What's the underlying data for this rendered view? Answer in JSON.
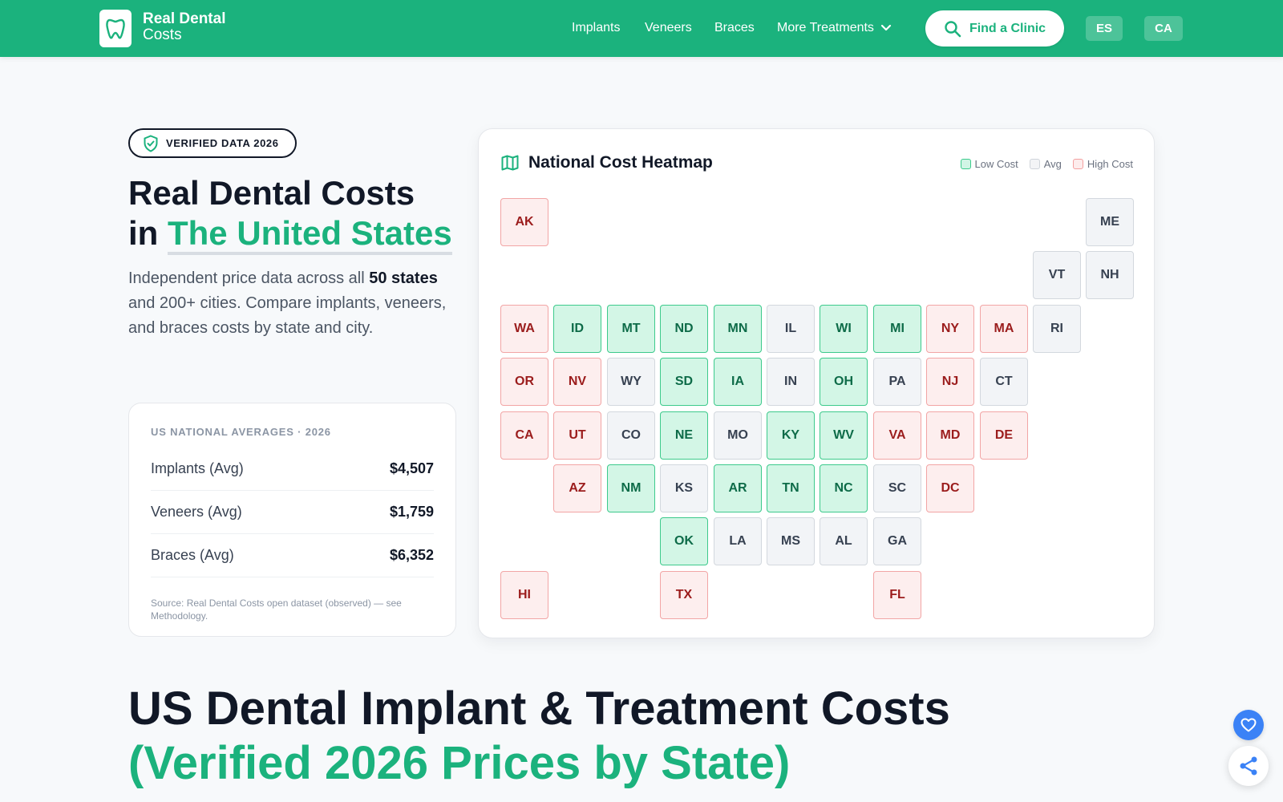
{
  "header": {
    "logo_line1": "Real Dental",
    "logo_line2": "Costs",
    "nav": [
      "Implants",
      "Veneers",
      "Braces",
      "More Treatments"
    ],
    "find_clinic": "Find a Clinic",
    "languages": [
      "ES",
      "CA"
    ]
  },
  "hero": {
    "badge": "VERIFIED DATA 2026",
    "title_line1": "Real Dental Costs",
    "title_prefix": "in ",
    "title_accent": "The United States",
    "desc_part1": "Independent price data across all ",
    "desc_bold": "50 states",
    "desc_part2": " and 200+ cities. Compare implants, veneers, and braces costs by state and city."
  },
  "averages": {
    "title": "US NATIONAL AVERAGES · 2026",
    "rows": [
      {
        "label": "Implants (Avg)",
        "value": "$4,507"
      },
      {
        "label": "Veneers (Avg)",
        "value": "$1,759"
      },
      {
        "label": "Braces (Avg)",
        "value": "$6,352"
      }
    ],
    "source": "Source: Real Dental Costs open dataset (observed) — see Methodology."
  },
  "heatmap": {
    "title": "National Cost Heatmap",
    "legend": {
      "low": "Low Cost",
      "avg": "Avg",
      "high": "High Cost"
    },
    "colors": {
      "low": "#d3f6e6",
      "avg": "#f2f4f7",
      "high": "#fdeeee",
      "brand": "#1bb27d"
    },
    "states": [
      {
        "abbr": "AK",
        "level": "high",
        "row": 0,
        "col": 0
      },
      {
        "abbr": "ME",
        "level": "avg",
        "row": 0,
        "col": 11
      },
      {
        "abbr": "VT",
        "level": "avg",
        "row": 1,
        "col": 10
      },
      {
        "abbr": "NH",
        "level": "avg",
        "row": 1,
        "col": 11
      },
      {
        "abbr": "WA",
        "level": "high",
        "row": 2,
        "col": 0
      },
      {
        "abbr": "ID",
        "level": "low",
        "row": 2,
        "col": 1
      },
      {
        "abbr": "MT",
        "level": "low",
        "row": 2,
        "col": 2
      },
      {
        "abbr": "ND",
        "level": "low",
        "row": 2,
        "col": 3
      },
      {
        "abbr": "MN",
        "level": "low",
        "row": 2,
        "col": 4
      },
      {
        "abbr": "IL",
        "level": "avg",
        "row": 2,
        "col": 5
      },
      {
        "abbr": "WI",
        "level": "low",
        "row": 2,
        "col": 6
      },
      {
        "abbr": "MI",
        "level": "low",
        "row": 2,
        "col": 7
      },
      {
        "abbr": "NY",
        "level": "high",
        "row": 2,
        "col": 8
      },
      {
        "abbr": "MA",
        "level": "high",
        "row": 2,
        "col": 9
      },
      {
        "abbr": "RI",
        "level": "avg",
        "row": 2,
        "col": 10
      },
      {
        "abbr": "OR",
        "level": "high",
        "row": 3,
        "col": 0
      },
      {
        "abbr": "NV",
        "level": "high",
        "row": 3,
        "col": 1
      },
      {
        "abbr": "WY",
        "level": "avg",
        "row": 3,
        "col": 2
      },
      {
        "abbr": "SD",
        "level": "low",
        "row": 3,
        "col": 3
      },
      {
        "abbr": "IA",
        "level": "low",
        "row": 3,
        "col": 4
      },
      {
        "abbr": "IN",
        "level": "avg",
        "row": 3,
        "col": 5
      },
      {
        "abbr": "OH",
        "level": "low",
        "row": 3,
        "col": 6
      },
      {
        "abbr": "PA",
        "level": "avg",
        "row": 3,
        "col": 7
      },
      {
        "abbr": "NJ",
        "level": "high",
        "row": 3,
        "col": 8
      },
      {
        "abbr": "CT",
        "level": "avg",
        "row": 3,
        "col": 9
      },
      {
        "abbr": "CA",
        "level": "high",
        "row": 4,
        "col": 0
      },
      {
        "abbr": "UT",
        "level": "high",
        "row": 4,
        "col": 1
      },
      {
        "abbr": "CO",
        "level": "avg",
        "row": 4,
        "col": 2
      },
      {
        "abbr": "NE",
        "level": "low",
        "row": 4,
        "col": 3
      },
      {
        "abbr": "MO",
        "level": "avg",
        "row": 4,
        "col": 4
      },
      {
        "abbr": "KY",
        "level": "low",
        "row": 4,
        "col": 5
      },
      {
        "abbr": "WV",
        "level": "low",
        "row": 4,
        "col": 6
      },
      {
        "abbr": "VA",
        "level": "high",
        "row": 4,
        "col": 7
      },
      {
        "abbr": "MD",
        "level": "high",
        "row": 4,
        "col": 8
      },
      {
        "abbr": "DE",
        "level": "high",
        "row": 4,
        "col": 9
      },
      {
        "abbr": "AZ",
        "level": "high",
        "row": 5,
        "col": 1
      },
      {
        "abbr": "NM",
        "level": "low",
        "row": 5,
        "col": 2
      },
      {
        "abbr": "KS",
        "level": "avg",
        "row": 5,
        "col": 3
      },
      {
        "abbr": "AR",
        "level": "low",
        "row": 5,
        "col": 4
      },
      {
        "abbr": "TN",
        "level": "low",
        "row": 5,
        "col": 5
      },
      {
        "abbr": "NC",
        "level": "low",
        "row": 5,
        "col": 6
      },
      {
        "abbr": "SC",
        "level": "avg",
        "row": 5,
        "col": 7
      },
      {
        "abbr": "DC",
        "level": "high",
        "row": 5,
        "col": 8
      },
      {
        "abbr": "OK",
        "level": "low",
        "row": 6,
        "col": 3
      },
      {
        "abbr": "LA",
        "level": "avg",
        "row": 6,
        "col": 4
      },
      {
        "abbr": "MS",
        "level": "avg",
        "row": 6,
        "col": 5
      },
      {
        "abbr": "AL",
        "level": "avg",
        "row": 6,
        "col": 6
      },
      {
        "abbr": "GA",
        "level": "avg",
        "row": 6,
        "col": 7
      },
      {
        "abbr": "HI",
        "level": "high",
        "row": 7,
        "col": 0
      },
      {
        "abbr": "TX",
        "level": "high",
        "row": 7,
        "col": 3
      },
      {
        "abbr": "FL",
        "level": "high",
        "row": 7,
        "col": 7
      }
    ]
  },
  "section": {
    "title_line1": "US Dental Implant & Treatment Costs",
    "title_line2": "(Verified 2026 Prices by State)"
  },
  "icons": [
    "tooth-logo-icon",
    "search-icon",
    "chevron-down-icon",
    "shield-check-icon",
    "map-icon",
    "heart-icon",
    "share-icon"
  ]
}
